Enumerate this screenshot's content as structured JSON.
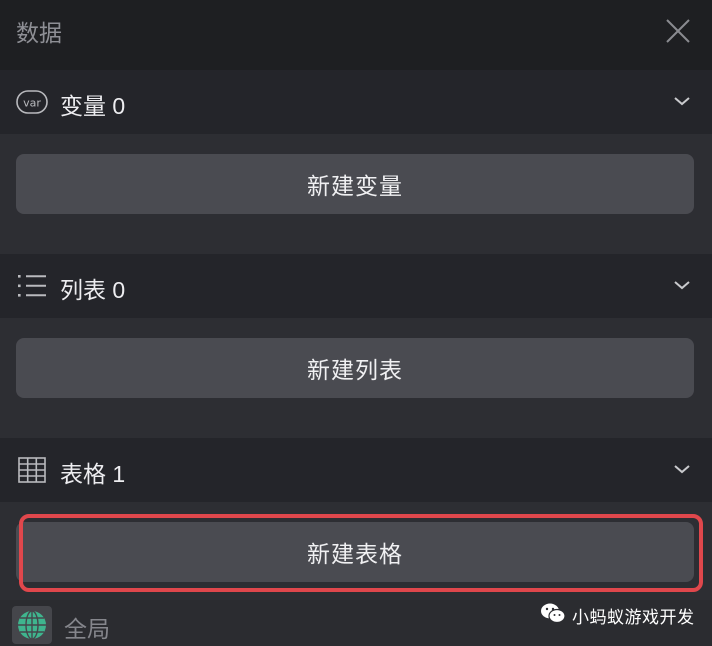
{
  "panel": {
    "title": "数据"
  },
  "sections": {
    "variables": {
      "label": "变量 0",
      "icon": "var-badge-icon",
      "button_label": "新建变量"
    },
    "lists": {
      "label": "列表 0",
      "icon": "list-icon",
      "button_label": "新建列表"
    },
    "tables": {
      "label": "表格 1",
      "icon": "grid-table-icon",
      "button_label": "新建表格"
    }
  },
  "footer": {
    "scope_label": "全局",
    "icon": "globe-icon"
  },
  "watermark": {
    "text": "小蚂蚁游戏开发",
    "icon": "wechat-icon"
  },
  "colors": {
    "header_bg": "#1e1f22",
    "section_head_bg": "#24252a",
    "section_body_bg": "#2d2e33",
    "button_bg": "#4a4b51",
    "highlight": "#e0474c",
    "globe": "#3fb58e"
  }
}
